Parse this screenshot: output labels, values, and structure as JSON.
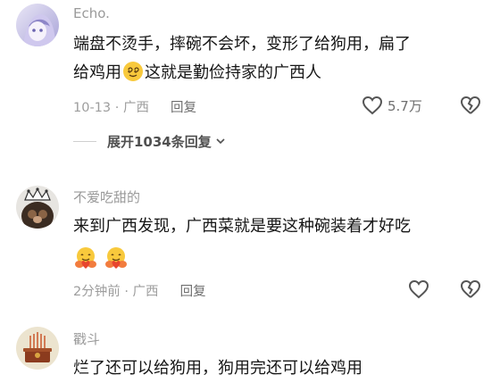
{
  "comments": [
    {
      "username": "Echo.",
      "text_line1": "端盘不烫手，摔碗不会坏，变形了给狗用，扁了",
      "text_line2_a": "给鸡用",
      "emoji_1": "smiling-face-with-spiral-eyes-emoji",
      "text_line2_b": "这就是勤俭持家的广西人",
      "time_location": "10-13 · 广西",
      "reply_label": "回复",
      "like_count": "5.7万",
      "expand_label": "展开1034条回复"
    },
    {
      "username": "不爱吃甜的",
      "text_line1": "来到广西发现，广西菜就是要这种碗装着才好吃",
      "emojis": [
        "hugging-face-emoji",
        "hugging-face-emoji"
      ],
      "time_location": "2分钟前 · 广西",
      "reply_label": "回复"
    },
    {
      "username": "戳斗",
      "text_line1": "烂了还可以给狗用，狗用完还可以给鸡用"
    }
  ],
  "colors": {
    "username": "#9a9a9a",
    "text": "#161616",
    "meta": "#9d9d9d",
    "icon": "#555555"
  }
}
